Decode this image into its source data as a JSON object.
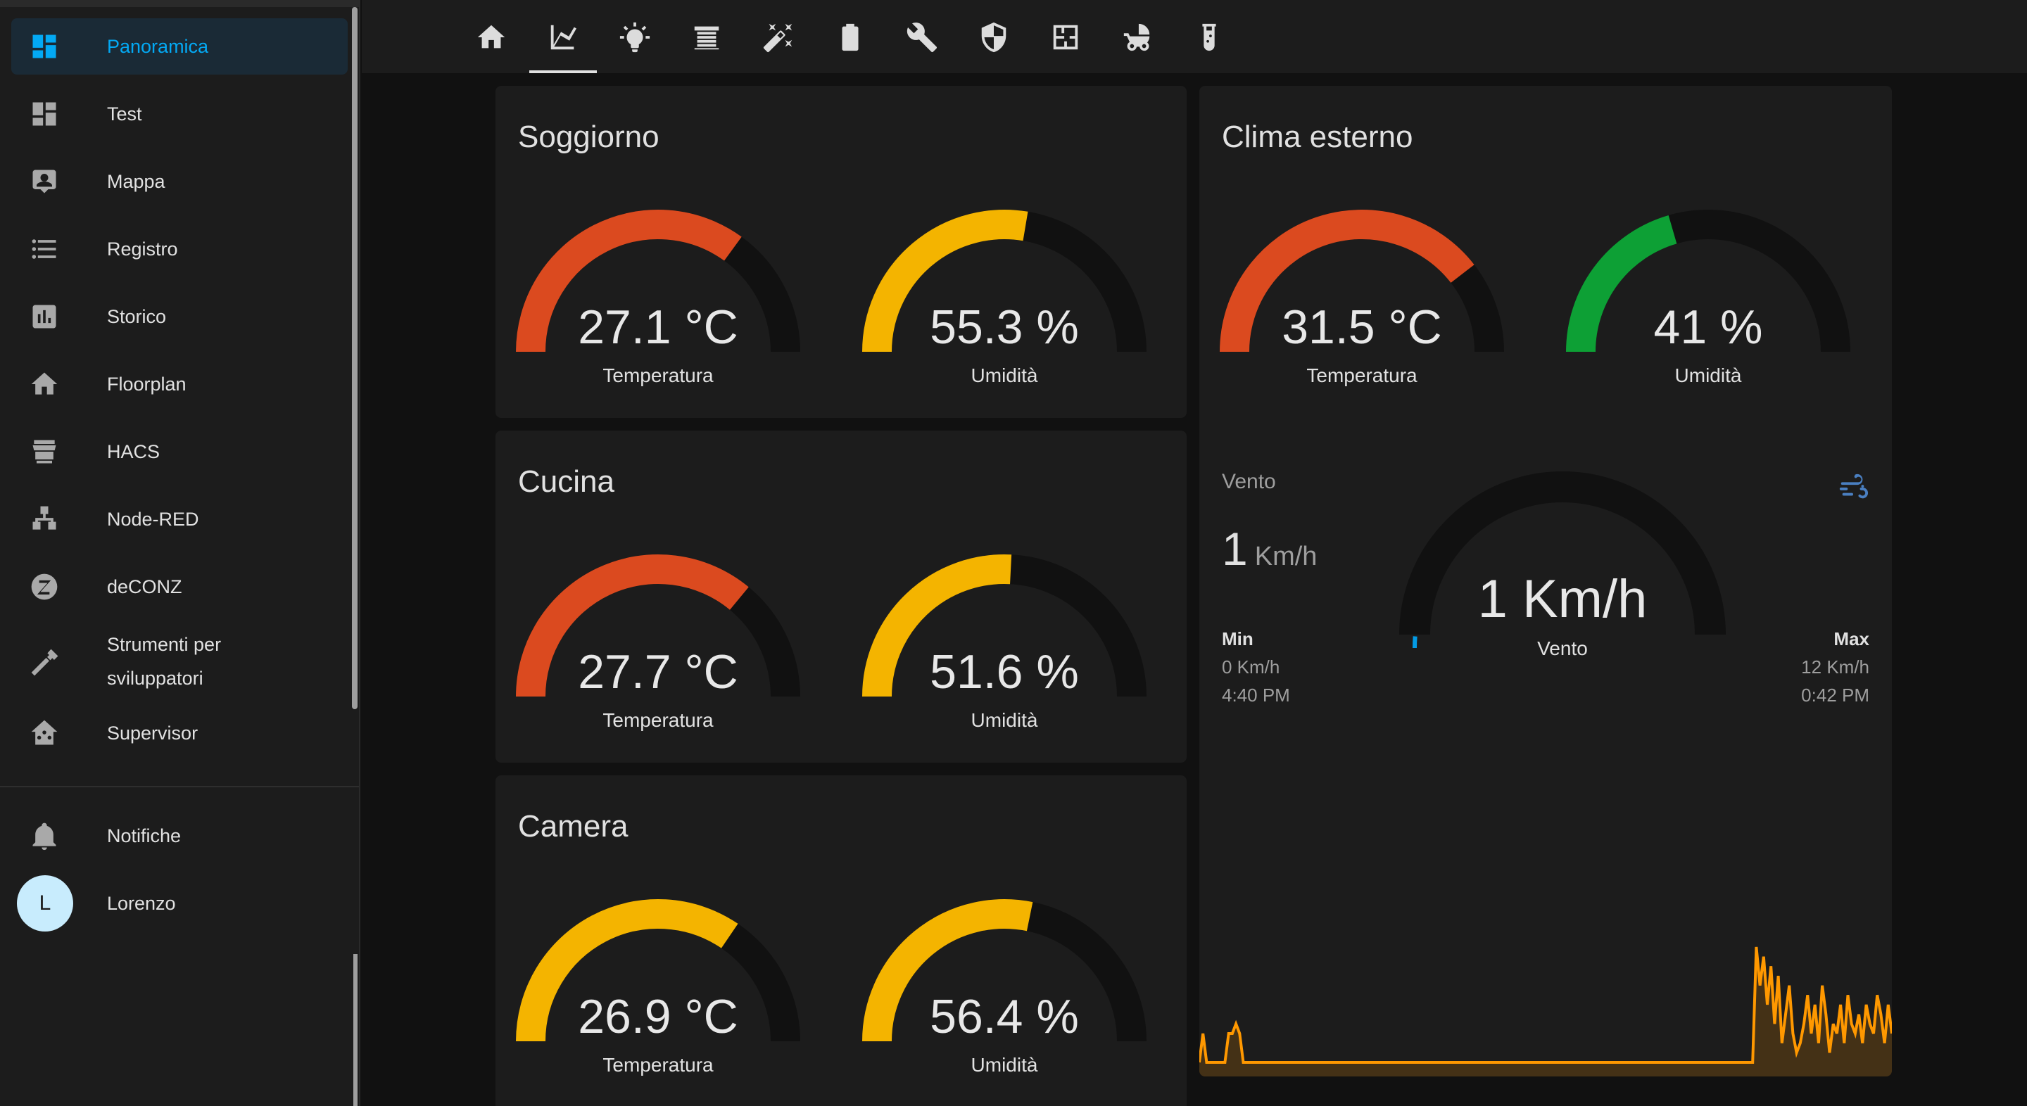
{
  "sidebar": {
    "items": [
      {
        "label": "Panoramica",
        "icon": "dashboard-icon",
        "active": true
      },
      {
        "label": "Test",
        "icon": "dashboard-icon"
      },
      {
        "label": "Mappa",
        "icon": "account-box-icon"
      },
      {
        "label": "Registro",
        "icon": "format-list-icon"
      },
      {
        "label": "Storico",
        "icon": "chart-box-icon"
      },
      {
        "label": "Floorplan",
        "icon": "home-icon"
      },
      {
        "label": "HACS",
        "icon": "hacs-store-icon"
      },
      {
        "label": "Node-RED",
        "icon": "sitemap-icon"
      },
      {
        "label": "deCONZ",
        "icon": "zigbee-icon"
      },
      {
        "label": "Strumenti per",
        "label2": "sviluppatori",
        "icon": "hammer-icon"
      },
      {
        "label": "Supervisor",
        "icon": "home-assistant-icon"
      }
    ],
    "notifications": {
      "label": "Notifiche",
      "icon": "bell-icon"
    },
    "user": {
      "label": "Lorenzo",
      "initial": "L"
    }
  },
  "header": {
    "tabs": [
      "home-icon",
      "chart-line-icon",
      "lightbulb-icon",
      "blinds-icon",
      "magic-wand-icon",
      "battery-icon",
      "wrench-icon",
      "shield-icon",
      "floor-plan-icon",
      "stroller-icon",
      "test-tube-icon"
    ],
    "active_tab": 1
  },
  "cards": {
    "soggiorno": {
      "title": "Soggiorno",
      "temp": {
        "value": "27.1 °C",
        "label": "Temperatura",
        "fraction": 0.7,
        "color": "#db4a1f"
      },
      "hum": {
        "value": "55.3 %",
        "label": "Umidità",
        "fraction": 0.553,
        "color": "#f4b400"
      }
    },
    "cucina": {
      "title": "Cucina",
      "temp": {
        "value": "27.7 °C",
        "label": "Temperatura",
        "fraction": 0.72,
        "color": "#db4a1f"
      },
      "hum": {
        "value": "51.6 %",
        "label": "Umidità",
        "fraction": 0.516,
        "color": "#f4b400"
      }
    },
    "camera": {
      "title": "Camera",
      "temp": {
        "value": "26.9 °C",
        "label": "Temperatura",
        "fraction": 0.69,
        "color": "#f4b400"
      },
      "hum": {
        "value": "56.4 %",
        "label": "Umidità",
        "fraction": 0.564,
        "color": "#f4b400"
      }
    },
    "clima": {
      "title": "Clima esterno",
      "temp": {
        "value": "31.5 °C",
        "label": "Temperatura",
        "fraction": 0.79,
        "color": "#db4a1f"
      },
      "hum": {
        "value": "41 %",
        "label": "Umidità",
        "fraction": 0.41,
        "color": "#0da035"
      },
      "wind": {
        "value": "1 Km/h",
        "label": "Vento",
        "fraction": 0.025,
        "color": "#039be5"
      },
      "sensor": {
        "title": "Vento",
        "icon": "weather-windy-icon",
        "value": "1",
        "unit": "Km/h",
        "min_label": "Min",
        "min_value": "0 Km/h",
        "min_time": "4:40 PM",
        "max_label": "Max",
        "max_value": "12 Km/h",
        "max_time": "0:42 PM",
        "line_color": "#ff9800"
      }
    }
  },
  "chart_data": {
    "type": "area",
    "values": [
      0,
      3,
      0,
      0,
      0,
      0,
      0,
      0,
      3,
      3,
      4,
      3,
      0,
      0,
      0,
      0,
      0,
      0,
      0,
      0,
      0,
      0,
      0,
      0,
      0,
      0,
      0,
      0,
      0,
      0,
      0,
      0,
      0,
      0,
      0,
      0,
      0,
      0,
      0,
      0,
      0,
      0,
      0,
      0,
      0,
      0,
      0,
      0,
      0,
      0,
      0,
      0,
      0,
      0,
      0,
      0,
      0,
      0,
      0,
      0,
      0,
      0,
      0,
      0,
      0,
      0,
      0,
      0,
      0,
      0,
      0,
      0,
      0,
      0,
      0,
      0,
      0,
      0,
      0,
      0,
      0,
      0,
      0,
      0,
      0,
      0,
      0,
      0,
      0,
      0,
      0,
      0,
      0,
      0,
      0,
      0,
      0,
      0,
      0,
      0,
      0,
      0,
      0,
      0,
      0,
      0,
      0,
      0,
      0,
      0,
      0,
      0,
      0,
      0,
      0,
      0,
      0,
      0,
      0,
      0,
      0,
      0,
      0,
      0,
      0,
      0,
      0,
      0,
      0,
      0,
      0,
      0,
      0,
      0,
      0,
      0,
      0,
      0,
      0,
      0,
      0,
      0,
      0,
      0,
      0,
      0,
      0,
      0,
      0,
      0,
      0,
      0,
      12,
      8,
      11,
      6,
      10,
      4,
      9,
      2,
      5,
      8,
      3,
      1,
      2,
      4,
      7,
      3,
      6,
      2,
      8,
      5,
      1,
      4,
      3,
      6,
      2,
      7,
      4,
      3,
      5,
      2,
      6,
      4,
      3,
      7,
      5,
      2,
      6,
      3
    ],
    "ylim": [
      0,
      12
    ]
  }
}
